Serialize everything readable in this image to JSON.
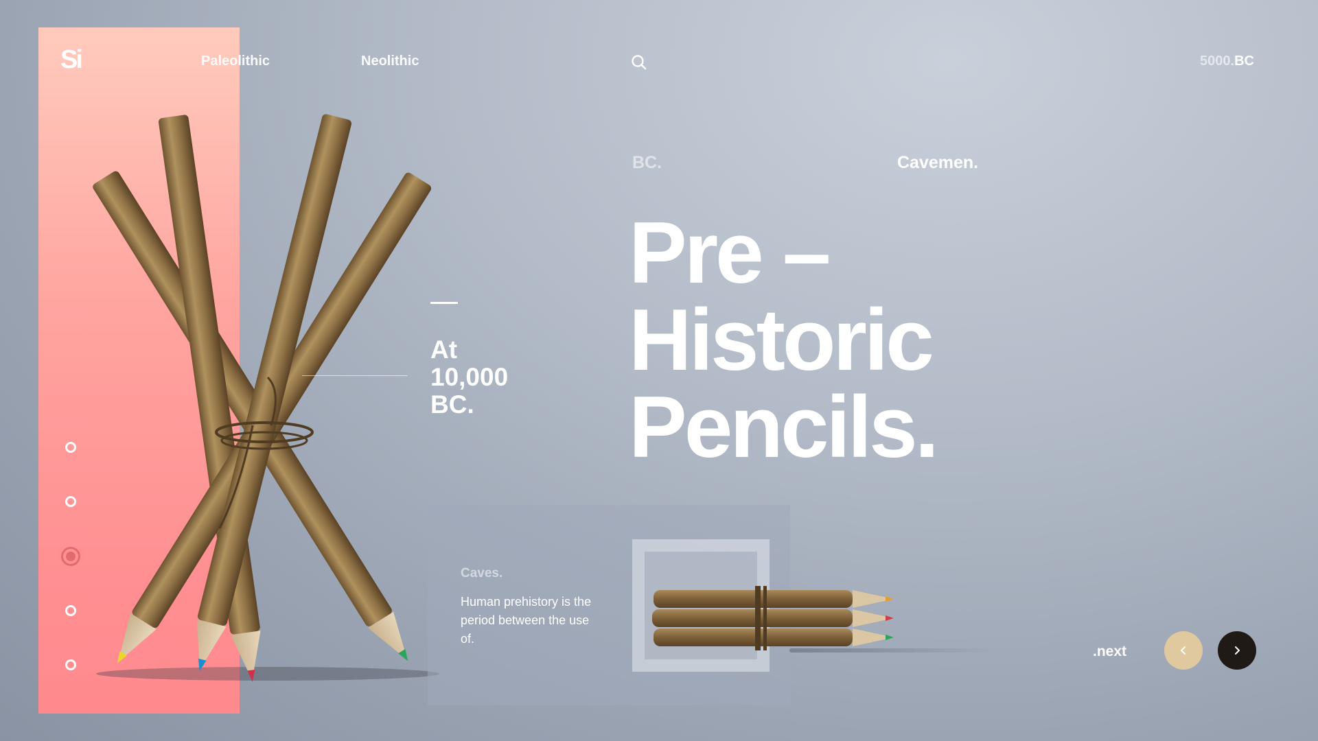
{
  "brand": {
    "logo": "Si"
  },
  "nav": {
    "items": [
      {
        "label": "Paleolithic"
      },
      {
        "label": "Neolithic"
      }
    ],
    "search_icon": "search-icon",
    "year_prefix": "5000.",
    "year_suffix": "BC"
  },
  "pagination": {
    "total": 5,
    "active_index": 2
  },
  "callout": {
    "line1": "At",
    "line2": "10,000",
    "line3": "BC."
  },
  "hero": {
    "kicker_left": "BC.",
    "kicker_right": "Cavemen.",
    "title_line1": "Pre –",
    "title_line2": "Historic",
    "title_line3": "Pencils."
  },
  "card": {
    "label": "Caves.",
    "text": "Human prehistory is the period between the use of."
  },
  "controls": {
    "next_label": ".next",
    "prev_icon": "chevron-left-icon",
    "next_icon": "chevron-right-icon"
  },
  "colors": {
    "accent_pink": "#ff8f92",
    "prev_button": "#e0c89f",
    "next_button": "#1f1a16",
    "active_dot": "#e26b70"
  }
}
